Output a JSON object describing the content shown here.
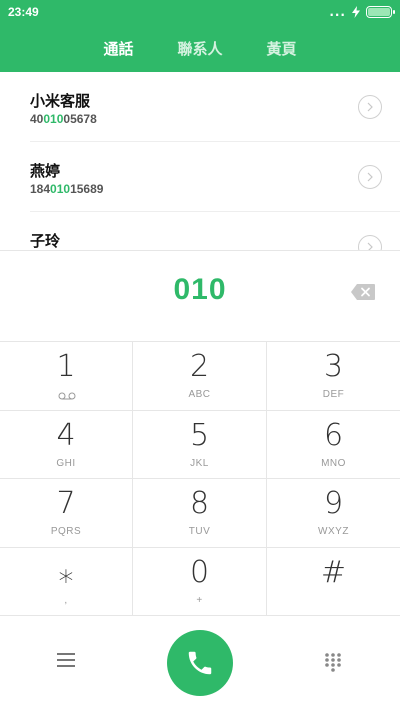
{
  "status_bar": {
    "time": "23:49",
    "signal_dots": "...",
    "battery_level": 1.0,
    "charging_icon": "bolt-icon"
  },
  "tabs": [
    {
      "label": "通話",
      "active": true
    },
    {
      "label": "聯系人",
      "active": false
    },
    {
      "label": "黃頁",
      "active": false
    }
  ],
  "contacts": [
    {
      "name": "小米客服",
      "number_before": "40",
      "number_match": "010",
      "number_after": "05678"
    },
    {
      "name": "燕婷",
      "number_before": "184",
      "number_match": "010",
      "number_after": "15689"
    },
    {
      "name": "子玲",
      "number_before": "",
      "number_match": "",
      "number_after": ""
    }
  ],
  "dialer": {
    "dialed_number": "010",
    "backspace_icon": "backspace-icon"
  },
  "keypad": [
    {
      "digit": "1",
      "letters": "",
      "icon": "voicemail-icon"
    },
    {
      "digit": "2",
      "letters": "ABC"
    },
    {
      "digit": "3",
      "letters": "DEF"
    },
    {
      "digit": "4",
      "letters": "GHI"
    },
    {
      "digit": "5",
      "letters": "JKL"
    },
    {
      "digit": "6",
      "letters": "MNO"
    },
    {
      "digit": "7",
      "letters": "PQRS"
    },
    {
      "digit": "8",
      "letters": "TUV"
    },
    {
      "digit": "9",
      "letters": "WXYZ"
    },
    {
      "digit": "⁎",
      "letters": ","
    },
    {
      "digit": "0",
      "letters": "+"
    },
    {
      "digit": "#",
      "letters": ""
    }
  ],
  "bottom_bar": {
    "menu_icon": "menu-icon",
    "call_icon": "phone-icon",
    "dialpad_icon": "dialpad-icon"
  },
  "colors": {
    "accent": "#2fb969",
    "match_highlight": "#2fb969"
  }
}
